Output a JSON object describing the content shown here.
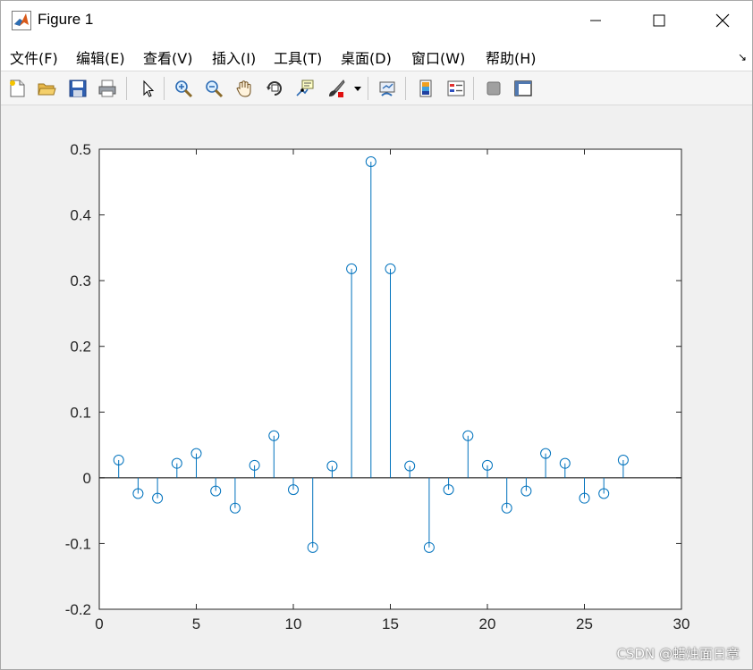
{
  "window": {
    "title": "Figure 1",
    "icon": "matlab-icon",
    "controls": [
      "minimize-icon",
      "maximize-icon",
      "close-icon"
    ]
  },
  "menubar": {
    "items": [
      {
        "label": "文件(F)"
      },
      {
        "label": "编辑(E)"
      },
      {
        "label": "查看(V)"
      },
      {
        "label": "插入(I)"
      },
      {
        "label": "工具(T)"
      },
      {
        "label": "桌面(D)"
      },
      {
        "label": "窗口(W)"
      },
      {
        "label": "帮助(H)"
      }
    ],
    "dock_arrow": "↘"
  },
  "toolbar": {
    "buttons": [
      "new-figure-icon",
      "open-file-icon",
      "save-icon",
      "print-icon",
      "edit-plot-arrow-icon",
      "zoom-in-icon",
      "zoom-out-icon",
      "pan-hand-icon",
      "rotate-3d-icon",
      "data-cursor-icon",
      "brush-icon",
      "brush-dropdown-icon",
      "link-plot-icon",
      "insert-colorbar-icon",
      "insert-legend-icon",
      "hide-plot-tools-icon",
      "show-plot-tools-icon"
    ]
  },
  "chart_data": {
    "type": "stem",
    "x": [
      1,
      2,
      3,
      4,
      5,
      6,
      7,
      8,
      9,
      10,
      11,
      12,
      13,
      14,
      15,
      16,
      17,
      18,
      19,
      20,
      21,
      22,
      23,
      24,
      25,
      26,
      27
    ],
    "values": [
      0.027,
      -0.024,
      -0.031,
      0.022,
      0.037,
      -0.02,
      -0.046,
      0.019,
      0.064,
      -0.018,
      -0.106,
      0.018,
      0.318,
      0.481,
      0.318,
      0.018,
      -0.106,
      -0.018,
      0.064,
      0.019,
      -0.046,
      -0.02,
      0.037,
      0.022,
      -0.031,
      -0.024,
      0.027
    ],
    "xlim": [
      0,
      30
    ],
    "ylim": [
      -0.2,
      0.5
    ],
    "xticks": [
      "0",
      "5",
      "10",
      "15",
      "20",
      "25",
      "30"
    ],
    "yticks": [
      "-0.2",
      "-0.1",
      "0",
      "0.1",
      "0.2",
      "0.3",
      "0.4",
      "0.5"
    ],
    "title": "",
    "xlabel": "",
    "ylabel": "",
    "grid": false,
    "color": "#0072bd",
    "marker": "circle"
  },
  "watermark": "CSDN @蜡烛面日章"
}
